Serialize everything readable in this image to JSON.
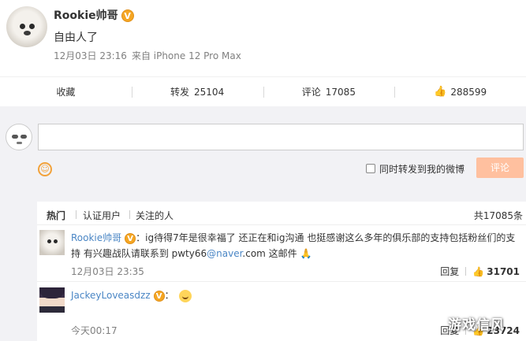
{
  "post": {
    "author": "Rookie帅哥",
    "verified_badge": "V",
    "text": "自由人了",
    "time": "12月03日 23:16",
    "source": "来自 iPhone 12 Pro Max"
  },
  "actions": {
    "favorite_label": "收藏",
    "repost_label": "转发",
    "repost_count": "25104",
    "comment_label": "评论",
    "comment_count": "17085",
    "like_count": "288599"
  },
  "composer": {
    "repost_checkbox_label": "同时转发到我的微博",
    "submit_label": "评论",
    "submit_color": "#ffc09f"
  },
  "comments_list": {
    "filters": [
      "热门",
      "认证用户",
      "关注的人"
    ],
    "total": "共17085条",
    "items": [
      {
        "name": "Rookie帅哥",
        "text_part1": "：ig待得7年是很幸福了 还正在和ig沟通 也挺感谢这么多年的俱乐部的支持包括粉丝们的支持 有兴趣战队请联系到 pwty66",
        "mention": "@naver",
        "text_part2": ".com 这邮件",
        "emoji": "pray-icon",
        "time": "12月03日 23:35",
        "reply_label": "回复",
        "likes": "31701"
      },
      {
        "name": "JackeyLoveasdzz",
        "text_part1": "：",
        "emoji": "crying-icon",
        "time": "今天00:17",
        "reply_label": "回复",
        "likes": "23724"
      }
    ]
  },
  "watermark": "游戏信风",
  "colors": {
    "accent": "#e8732a",
    "link": "#4a86c5",
    "badge": "#f5a623",
    "background": "#f2f2f5"
  }
}
